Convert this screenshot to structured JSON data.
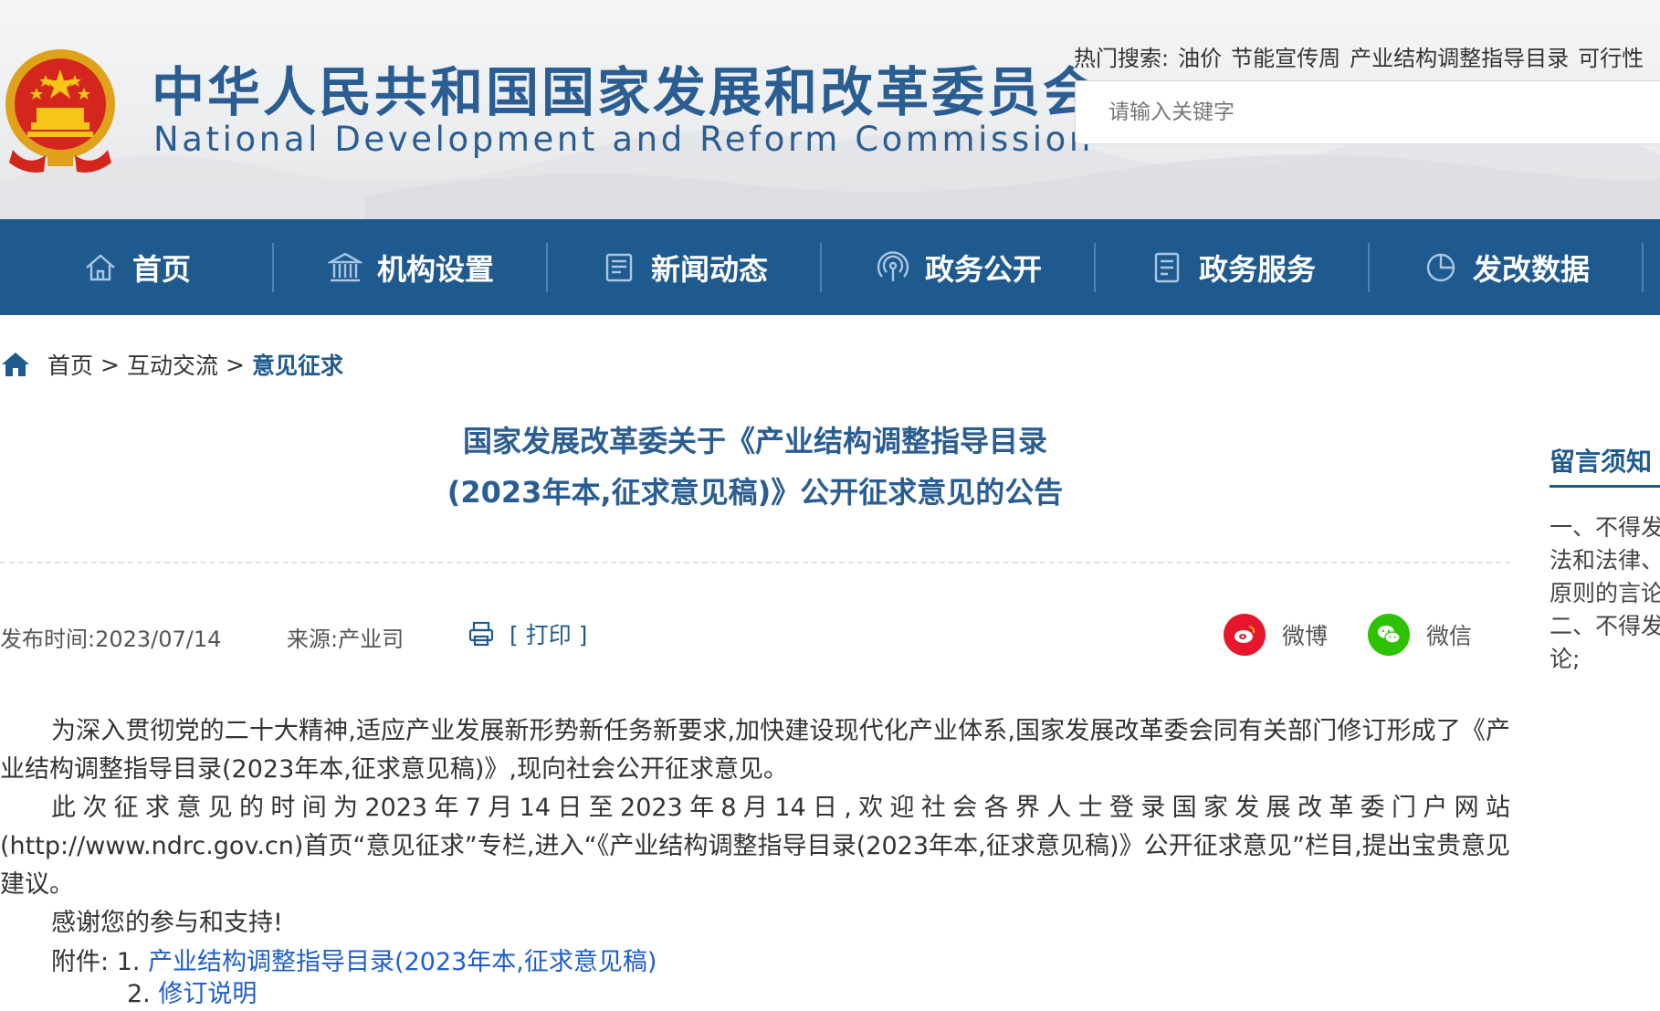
{
  "header": {
    "title_cn": "中华人民共和国国家发展和改革委员会",
    "title_en": "National Development and Reform Commission",
    "hot_label": "热门搜索:",
    "hot_terms": [
      "油价",
      "节能宣传周",
      "产业结构调整指导目录",
      "可行性"
    ],
    "search_placeholder": "请输入关键字"
  },
  "nav": {
    "items": [
      {
        "label": "首页",
        "icon": "home-icon"
      },
      {
        "label": "机构设置",
        "icon": "institution-icon"
      },
      {
        "label": "新闻动态",
        "icon": "news-icon"
      },
      {
        "label": "政务公开",
        "icon": "broadcast-icon"
      },
      {
        "label": "政务服务",
        "icon": "document-icon"
      },
      {
        "label": "发改数据",
        "icon": "pie-chart-icon"
      }
    ]
  },
  "breadcrumb": {
    "items": [
      "首页",
      "互动交流",
      "意见征求"
    ],
    "separator": ">"
  },
  "article": {
    "title_line1": "国家发展改革委关于《产业结构调整指导目录",
    "title_line2": "(2023年本,征求意见稿)》公开征求意见的公告",
    "publish_label": "发布时间:2023/07/14",
    "source_label": "来源:产业司",
    "print_label": "[ 打印 ]",
    "share_weibo": "微博",
    "share_wechat": "微信",
    "para1": "为深入贯彻党的二十大精神,适应产业发展新形势新任务新要求,加快建设现代化产业体系,国家发展改革委会同有关部门修订形成了《产业结构调整指导目录(2023年本,征求意见稿)》,现向社会公开征求意见。",
    "para2": "此次征求意见的时间为2023年7月14日至2023年8月14日,欢迎社会各界人士登录国家发展改革委门户网站(http://www.ndrc.gov.cn)首页“意见征求”专栏,进入“《产业结构调整指导目录(2023年本,征求意见稿)》公开征求意见”栏目,提出宝贵意见建议。",
    "para3": "感谢您的参与和支持!",
    "attach_label": "附件:",
    "attach1_num": "1.",
    "attach1_link": "产业结构调整指导目录(2023年本,征求意见稿)",
    "attach2_num": "2.",
    "attach2_link": "修订说明"
  },
  "side_panel": {
    "title": "留言须知",
    "lines": [
      "一、不得发",
      "法和法律、",
      "原则的言论",
      "二、不得发",
      "论;"
    ]
  },
  "colors": {
    "brand_blue": "#1f5a8f",
    "title_blue": "#2a5d91",
    "link_blue": "#1f5ec9",
    "weibo_red": "#e6162d",
    "wechat_green": "#2dc100"
  }
}
